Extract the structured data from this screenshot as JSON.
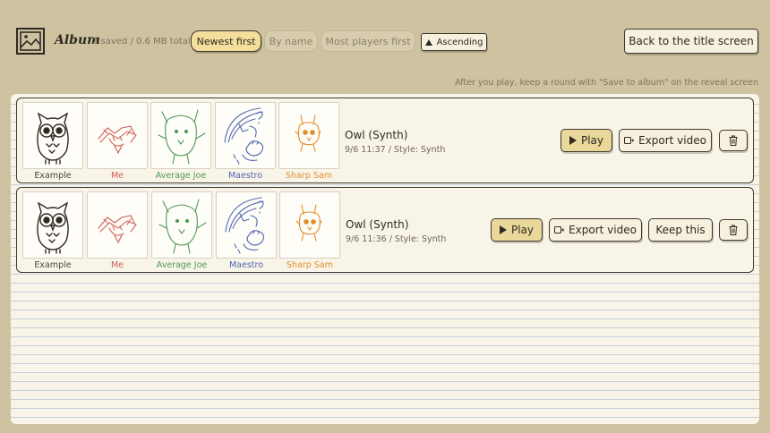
{
  "header": {
    "title": "Album",
    "count_text": "2 saved / 0.6 MB total",
    "sort_options": [
      "Newest first",
      "By name",
      "Most players first"
    ],
    "order_label": "Ascending",
    "back_label": "Back to the title screen",
    "hint": "After you play, keep a round with \"Save to album\" on the reveal screen"
  },
  "players": [
    "Example",
    "Me",
    "Average Joe",
    "Maestro",
    "Sharp Sam"
  ],
  "entries": [
    {
      "title": "Owl (Synth)",
      "meta": "9/6 11:37 / Style: Synth",
      "play_label": "Play",
      "export_label": "Export video"
    },
    {
      "title": "Owl (Synth)",
      "meta": "9/6 11:36 / Style: Synth",
      "play_label": "Play",
      "export_label": "Export video",
      "keep_label": "Keep this"
    }
  ],
  "icons": {
    "album": "picture-frame-icon",
    "play": "play-triangle-icon",
    "export": "video-camera-icon",
    "delete": "trash-icon",
    "order": "triangle-up-icon"
  },
  "colors": {
    "background": "#cfc2a1",
    "paper": "#f8f4e8",
    "active_sort": "#f3de9c",
    "play_button": "#ead79a",
    "me": "#d0605a",
    "average_joe": "#4e9a55",
    "maestro": "#4d66b0",
    "sharp_sam": "#e0902c"
  }
}
